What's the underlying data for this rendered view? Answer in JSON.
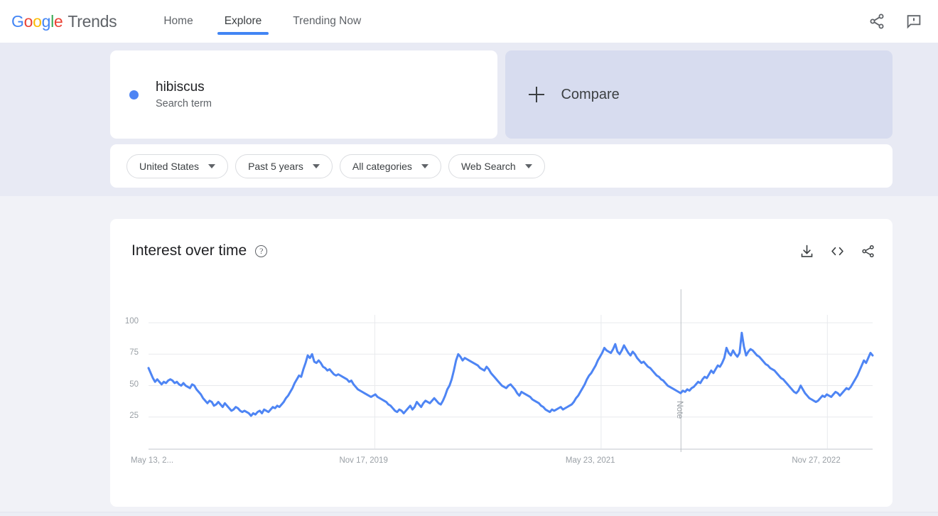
{
  "header": {
    "logo": {
      "word1": "Google",
      "word2": "Trends"
    },
    "nav": [
      {
        "label": "Home",
        "active": false
      },
      {
        "label": "Explore",
        "active": true
      },
      {
        "label": "Trending Now",
        "active": false
      }
    ],
    "actions": [
      {
        "name": "share-icon",
        "label": "Share"
      },
      {
        "name": "feedback-icon",
        "label": "Send feedback"
      }
    ]
  },
  "query": {
    "term": {
      "name": "hibiscus",
      "type": "Search term",
      "dot_color": "#4e85f4"
    },
    "compare": {
      "label": "Compare",
      "icon": "plus-icon"
    }
  },
  "filters": [
    {
      "name": "location-filter",
      "label": "United States"
    },
    {
      "name": "time-range-filter",
      "label": "Past 5 years"
    },
    {
      "name": "category-filter",
      "label": "All categories"
    },
    {
      "name": "search-type-filter",
      "label": "Web Search"
    }
  ],
  "chart_panel": {
    "title": "Interest over time",
    "help": "?",
    "tools": [
      {
        "name": "download-icon",
        "label": "Download CSV"
      },
      {
        "name": "embed-code-icon",
        "label": "Embed"
      },
      {
        "name": "share-icon",
        "label": "Share"
      }
    ]
  },
  "chart_data": {
    "type": "line",
    "title": "Interest over time",
    "xlabel": "",
    "ylabel": "",
    "ylim": [
      0,
      104
    ],
    "yticks": [
      25,
      50,
      75,
      100
    ],
    "ytick_labels": [
      "25",
      "50",
      "75",
      "100"
    ],
    "grid": true,
    "legend": false,
    "line_color": "#4e85f4",
    "series_name": "hibiscus",
    "xtick_labels": [
      "May 13, 2...",
      "Nov 17, 2019",
      "May 23, 2021",
      "Nov 27, 2022"
    ],
    "xtick_positions": [
      0,
      0.3125,
      0.625,
      0.9375
    ],
    "annotations": [
      {
        "label": "Note",
        "x_fraction": 0.7353,
        "orientation": "vertical"
      }
    ],
    "x_start": "May 13, 2018",
    "x_end": "May 2023",
    "values": [
      64,
      60,
      56,
      53,
      55,
      53,
      51,
      53,
      52,
      54,
      55,
      54,
      52,
      53,
      51,
      50,
      52,
      50,
      49,
      48,
      51,
      50,
      47,
      45,
      43,
      40,
      38,
      36,
      38,
      37,
      34,
      35,
      37,
      35,
      33,
      36,
      34,
      32,
      30,
      31,
      33,
      32,
      30,
      29,
      30,
      29,
      28,
      26,
      28,
      27,
      29,
      30,
      28,
      31,
      30,
      29,
      31,
      33,
      32,
      34,
      33,
      35,
      37,
      40,
      42,
      45,
      48,
      52,
      55,
      58,
      57,
      63,
      68,
      74,
      72,
      75,
      69,
      68,
      70,
      68,
      65,
      64,
      62,
      63,
      61,
      59,
      58,
      59,
      58,
      57,
      56,
      55,
      53,
      54,
      51,
      49,
      47,
      46,
      45,
      44,
      43,
      42,
      41,
      42,
      43,
      41,
      40,
      39,
      38,
      37,
      35,
      34,
      32,
      30,
      29,
      31,
      30,
      28,
      30,
      32,
      34,
      31,
      33,
      37,
      35,
      33,
      36,
      38,
      37,
      36,
      38,
      40,
      38,
      36,
      35,
      38,
      42,
      47,
      50,
      55,
      62,
      70,
      75,
      73,
      70,
      72,
      71,
      70,
      69,
      68,
      67,
      66,
      64,
      63,
      62,
      65,
      63,
      60,
      58,
      56,
      54,
      52,
      50,
      49,
      48,
      50,
      51,
      49,
      47,
      44,
      42,
      45,
      44,
      43,
      42,
      41,
      39,
      38,
      37,
      36,
      34,
      33,
      31,
      30,
      29,
      31,
      30,
      31,
      32,
      33,
      31,
      32,
      33,
      34,
      35,
      37,
      40,
      42,
      45,
      48,
      51,
      55,
      58,
      60,
      63,
      66,
      70,
      73,
      76,
      80,
      78,
      77,
      76,
      79,
      83,
      77,
      75,
      78,
      82,
      79,
      76,
      74,
      77,
      75,
      72,
      70,
      68,
      69,
      67,
      65,
      64,
      62,
      60,
      58,
      57,
      55,
      54,
      52,
      50,
      49,
      48,
      47,
      46,
      45,
      44,
      46,
      45,
      47,
      46,
      48,
      49,
      51,
      53,
      52,
      55,
      57,
      56,
      59,
      62,
      60,
      63,
      66,
      65,
      68,
      72,
      80,
      76,
      74,
      78,
      75,
      73,
      76,
      92,
      81,
      74,
      77,
      79,
      78,
      76,
      74,
      73,
      71,
      69,
      67,
      66,
      64,
      63,
      62,
      60,
      58,
      56,
      55,
      53,
      51,
      49,
      47,
      45,
      44,
      46,
      50,
      47,
      44,
      42,
      40,
      39,
      38,
      37,
      38,
      40,
      42,
      41,
      43,
      42,
      41,
      43,
      45,
      44,
      42,
      44,
      46,
      48,
      47,
      49,
      52,
      55,
      58,
      62,
      66,
      70,
      68,
      72,
      76,
      74
    ]
  }
}
